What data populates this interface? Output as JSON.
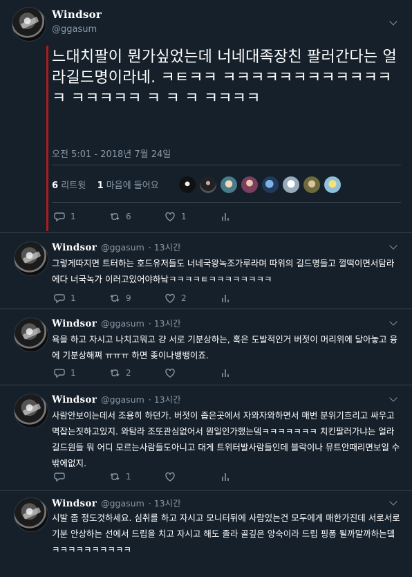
{
  "main_tweet": {
    "name": "Windsor",
    "handle": "@ggasum",
    "text": "느대치팔이 뭔가싶었는데 너네대족장친 팔러간다는 얼라길드명이라네. ㅋㅌㅋㅋ ㅋㅋㅋㅋㅋㅋㅋㅋㅋㅋㅋㅋㅋ ㅋㅋㅋㅋㅋ ㅋ ㅋ ㅋ ㅋㅋㅋㅋ",
    "timestamp": "오전 5:01 - 2018년 7월 24일",
    "retweet_count": "6",
    "retweet_label": "리트윗",
    "like_count": "1",
    "like_label": "마음에 들어요",
    "likers": [
      "avatar-1",
      "avatar-2",
      "avatar-3",
      "avatar-4",
      "avatar-5",
      "avatar-6",
      "avatar-7"
    ],
    "actions": {
      "reply": "1",
      "retweet": "6",
      "like": "1"
    }
  },
  "replies": [
    {
      "name": "Windsor",
      "handle": "@ggasum",
      "time": "· 13시간",
      "text": "그렇게따지면 트터하는 호드유저들도  너네국왕녹조가루라며 따위의 길드명들고 껄떡이면서탐라에다 너국녹가 이러고있어야하낰ㅋㅋㅋㅋㅌㅋㅋㅋㅋㅋㅋㅋㅋ",
      "actions": {
        "reply": "1",
        "retweet": "9",
        "like": "2"
      }
    },
    {
      "name": "Windsor",
      "handle": "@ggasum",
      "time": "· 13시간",
      "text": "욕을 하고 자시고 나치고뭐고 걍 서로 기분상하는, 혹은 도발적인거 버젓이 머리위에 달아놓고 융에 기분상해쪄 ㅠㅠㅠ 하면 좆이나뱅뱅이죠.",
      "actions": {
        "reply": "1",
        "retweet": "2",
        "like": ""
      }
    },
    {
      "name": "Windsor",
      "handle": "@ggasum",
      "time": "· 13시간",
      "text": "사람안보이는데서 조용히 하던가. 버젓이 좁은곳에서 자와자와하면서 매번 분위기흐리고 싸우고 멱잡는짓하고있지. 와탐라 조또관심없어서 뭔일인가했는뎈ㅋㅋㅋㅋㅋㅋㅋ 치킨팔러가냐는 얼라길드원들 뭐 어디 모르는사람들도아니고 대게 트위터발사람들인데 블락이나 뮤트안때리면보일 수 밖에없지.",
      "actions": {
        "reply": "",
        "retweet": "1",
        "like": ""
      }
    },
    {
      "name": "Windsor",
      "handle": "@ggasum",
      "time": "· 13시간",
      "text": "시발 좀 정도것하세요. 심취를 하고 자시고 모니터뒤에 사람있는건 모두에게 매한가진데 서로서로 기분 안상하는 선에서 드립을 치고 자시고 해도 졸라 골깊은 앙숙이라 드립 핑퐁 될까말까하는뎈ㅋㅋㅋㅋㅋㅋㅋㅋㅋㅋ",
      "actions": {
        "reply": "",
        "retweet": "",
        "like": ""
      }
    }
  ],
  "colors": {
    "background": "#15202b",
    "secondary_text": "#8899a6",
    "divider": "#38444d",
    "thread_line": "#b31b1b"
  }
}
